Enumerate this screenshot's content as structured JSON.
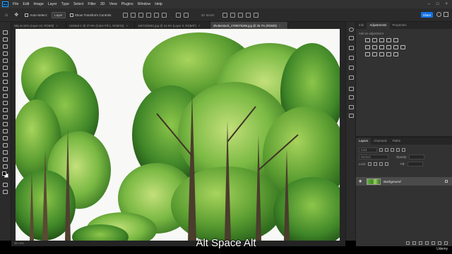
{
  "app": {
    "logo_text": "Ps"
  },
  "menu": [
    "File",
    "Edit",
    "Image",
    "Layer",
    "Type",
    "Select",
    "Filter",
    "3D",
    "View",
    "Plugins",
    "Window",
    "Help"
  ],
  "options_bar": {
    "auto_select_label": "Auto-Select:",
    "auto_select_value": "Layer",
    "show_transform_label": "Show Transform Controls",
    "mode_3d_label": "3D Mode:",
    "share_label": "Share"
  },
  "tabs": [
    {
      "label": "Sky at 44% (Layer 24, RGB/8)",
      "active": false
    },
    {
      "label": "Untitled-1 @ 37.9% (Color Fill 1, RGB/16)",
      "active": false
    },
    {
      "label": "1557334881.jpg @ 24.9% (Layer 0, RGB/8*)",
      "active": false
    },
    {
      "label": "shutterstock_1709076265.jpg @ 35.7% (RGB/8)",
      "active": true
    }
  ],
  "right_panel": {
    "top_tabs": [
      {
        "label": "Info",
        "active": false
      },
      {
        "label": "Adjustments",
        "active": true
      },
      {
        "label": "Properties",
        "active": false
      }
    ],
    "adjust_hint": "Add an adjustment",
    "adjust_icons": [
      [
        "brightness-icon",
        "levels-icon",
        "curves-icon",
        "exposure-icon",
        "vibrance-icon"
      ],
      [
        "hue-sat-icon",
        "color-balance-icon",
        "bw-icon",
        "photo-filter-icon",
        "channel-mixer-icon",
        "color-lookup-icon"
      ],
      [
        "invert-icon",
        "posterize-icon",
        "threshold-icon",
        "selective-color-icon",
        "gradient-map-icon"
      ]
    ],
    "layer_tabs": [
      {
        "label": "Layers",
        "active": true
      },
      {
        "label": "Channels",
        "active": false
      },
      {
        "label": "Paths",
        "active": false
      }
    ],
    "filter_label": "Kind",
    "blend_mode": "Normal",
    "opacity_label": "Opacity:",
    "opacity_value": "",
    "lock_label": "Lock:",
    "fill_label": "Fill:",
    "layer_name": "Background"
  },
  "status_text": "35.74%",
  "caption": "Alt Space Alt",
  "watermark": "Udemy",
  "colors": {
    "accent": "#1473e6",
    "panel": "#323232",
    "dark": "#262626"
  }
}
